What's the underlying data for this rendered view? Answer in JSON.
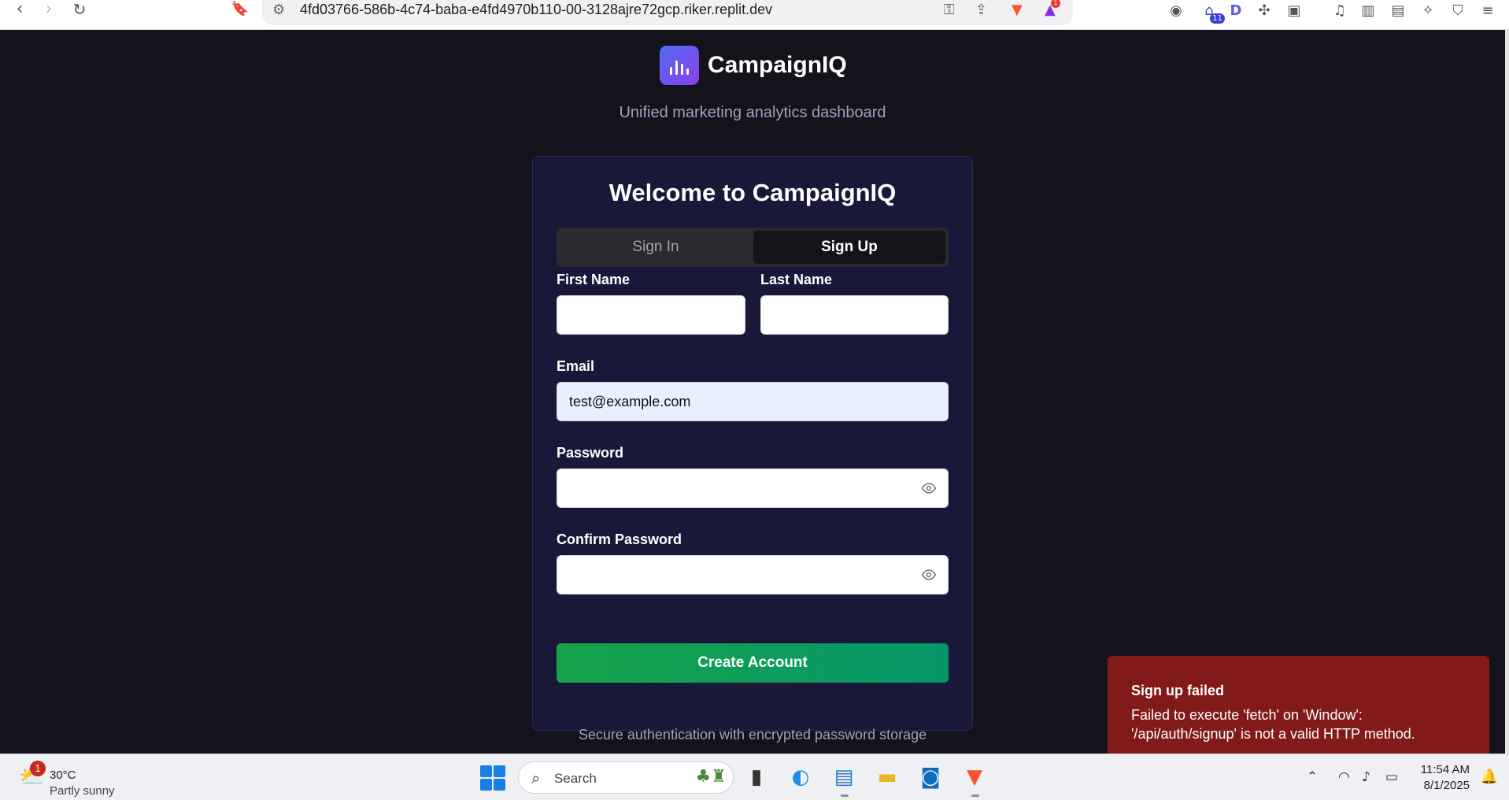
{
  "browser": {
    "url": "4fd03766-586b-4c74-baba-e4fd4970b110-00-3128ajre72gcp.riker.replit.dev",
    "rewards_badge": "1",
    "extension_badge": "11"
  },
  "app": {
    "name": "CampaignIQ",
    "tagline": "Unified marketing analytics dashboard"
  },
  "card": {
    "title": "Welcome to CampaignIQ",
    "tabs": [
      {
        "label": "Sign In",
        "active": false
      },
      {
        "label": "Sign Up",
        "active": true
      }
    ],
    "fields": {
      "first_name": {
        "label": "First Name",
        "value": ""
      },
      "last_name": {
        "label": "Last Name",
        "value": ""
      },
      "email": {
        "label": "Email",
        "value": "test@example.com"
      },
      "password": {
        "label": "Password",
        "value": ""
      },
      "confirm_password": {
        "label": "Confirm Password",
        "value": ""
      }
    },
    "submit_label": "Create Account"
  },
  "footer_note": "Secure authentication with encrypted password storage",
  "toast": {
    "title": "Sign up failed",
    "message": "Failed to execute 'fetch' on 'Window': '/api/auth/signup' is not a valid HTTP method."
  },
  "taskbar": {
    "weather": {
      "temp": "30°C",
      "desc": "Partly sunny",
      "badge": "1"
    },
    "search_label": "Search",
    "time": "11:54 AM",
    "date": "8/1/2025"
  },
  "colors": {
    "page_bg": "#14131c",
    "card_bg": "#191838",
    "primary_button": "#16a34a",
    "toast_bg": "#821a1a",
    "logo_gradient_start": "#4f6cf5",
    "logo_gradient_end": "#8b3fe6"
  }
}
